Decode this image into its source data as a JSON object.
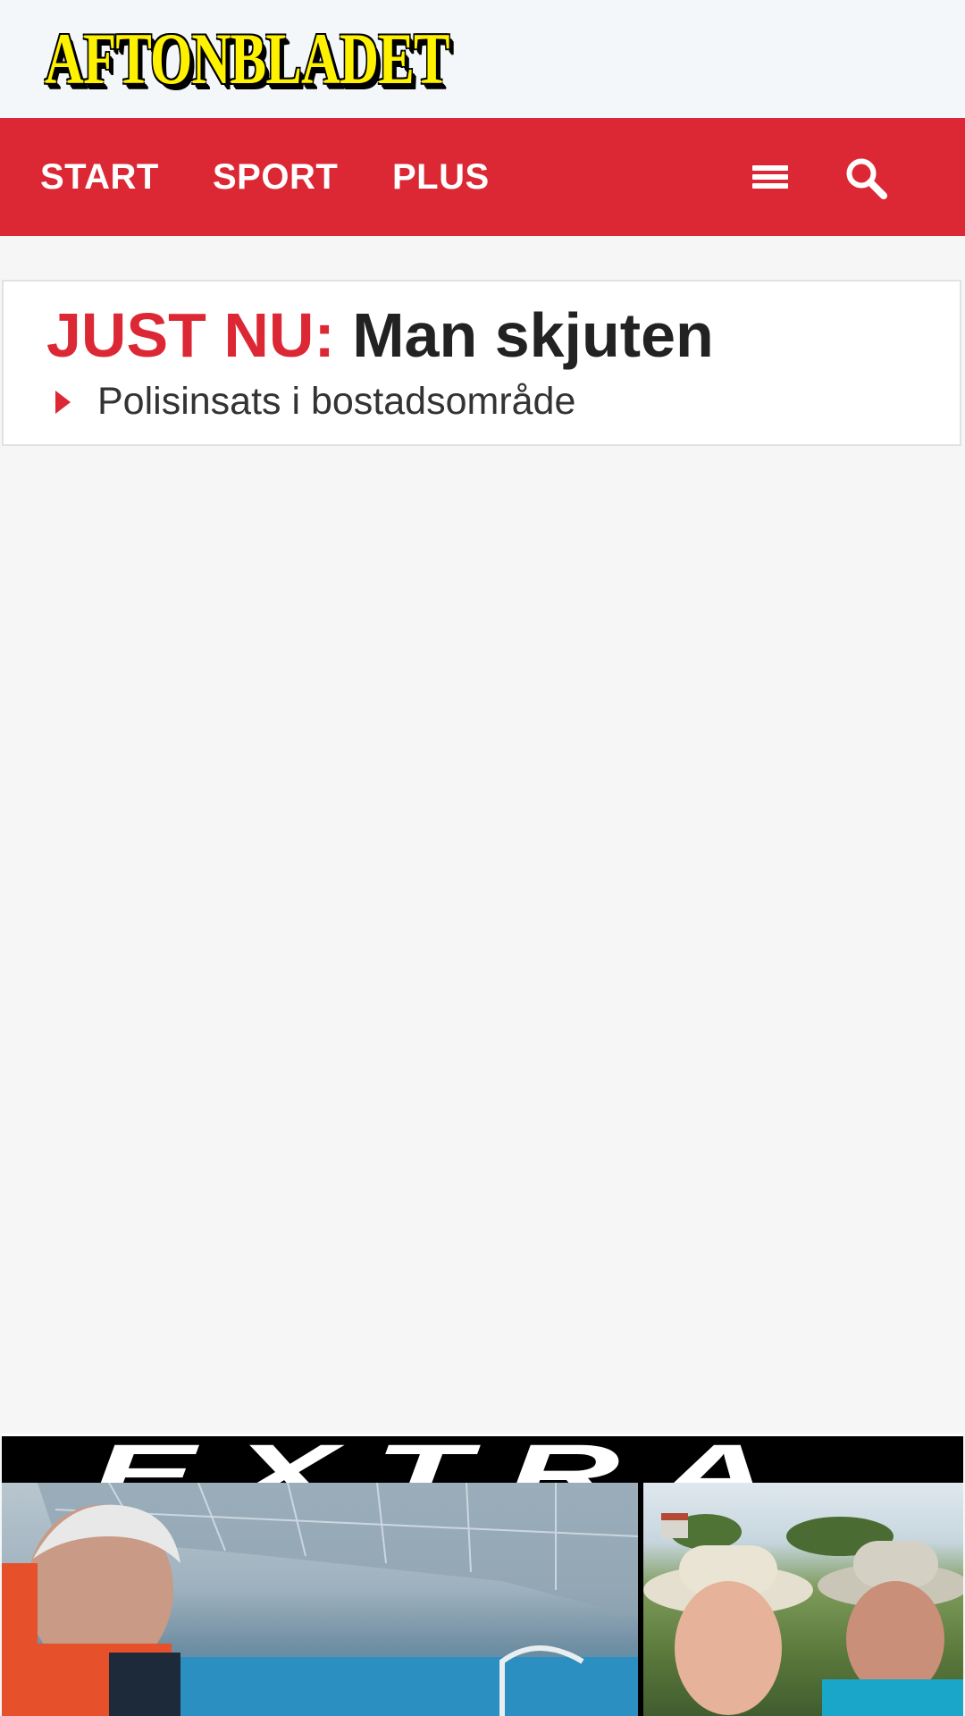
{
  "header": {
    "logo_text": "AFTONBLADET"
  },
  "nav": {
    "items": [
      {
        "label": "START"
      },
      {
        "label": "SPORT"
      },
      {
        "label": "PLUS"
      }
    ],
    "menu_icon": "hamburger-menu-icon",
    "search_icon": "search-icon"
  },
  "breaking": {
    "label": "JUST NU:",
    "title": "Man skjuten",
    "subtitle": "Polisinsats i bostadsområde",
    "arrow_icon": "play-arrow-icon"
  },
  "teaser": {
    "banner_text": "EXTRA"
  },
  "colors": {
    "brand_red": "#dc2834",
    "logo_yellow": "#fff200",
    "background": "#f6f6f6"
  }
}
